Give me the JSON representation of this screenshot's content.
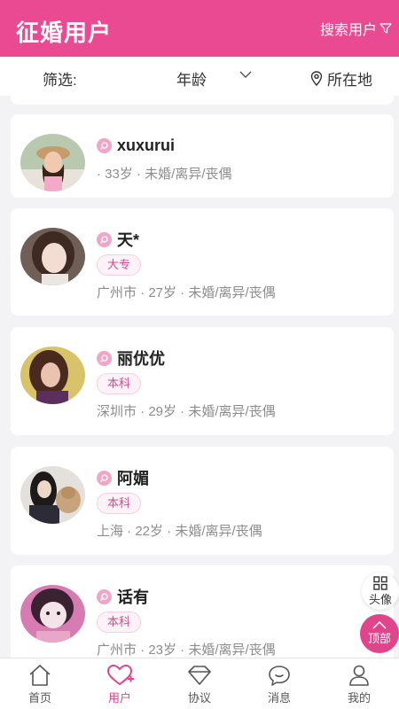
{
  "header": {
    "title": "征婚用户",
    "search_label": "搜索用户"
  },
  "filter": {
    "label": "筛选:",
    "age_label": "年龄",
    "location_label": "所在地"
  },
  "users": [
    {
      "name": "xuxurui",
      "education": "",
      "meta": "· 33岁 · 未婚/离异/丧偶"
    },
    {
      "name": "天*",
      "education": "大专",
      "meta": "广州市 · 27岁 · 未婚/离异/丧偶"
    },
    {
      "name": "丽优优",
      "education": "本科",
      "meta": "深圳市 · 29岁 · 未婚/离异/丧偶"
    },
    {
      "name": "阿媚",
      "education": "本科",
      "meta": "上海 · 22岁 · 未婚/离异/丧偶"
    },
    {
      "name": "话有",
      "education": "本科",
      "meta": "广州市 · 23岁 · 未婚/离异/丧偶"
    }
  ],
  "float": {
    "avatar_label": "头像",
    "top_label": "顶部"
  },
  "tabs": [
    {
      "label": "首页"
    },
    {
      "label": "用户"
    },
    {
      "label": "协议"
    },
    {
      "label": "消息"
    },
    {
      "label": "我的"
    }
  ],
  "colors": {
    "brand": "#ea4a92",
    "active": "#e0458c",
    "muted": "#8c8c8c"
  }
}
